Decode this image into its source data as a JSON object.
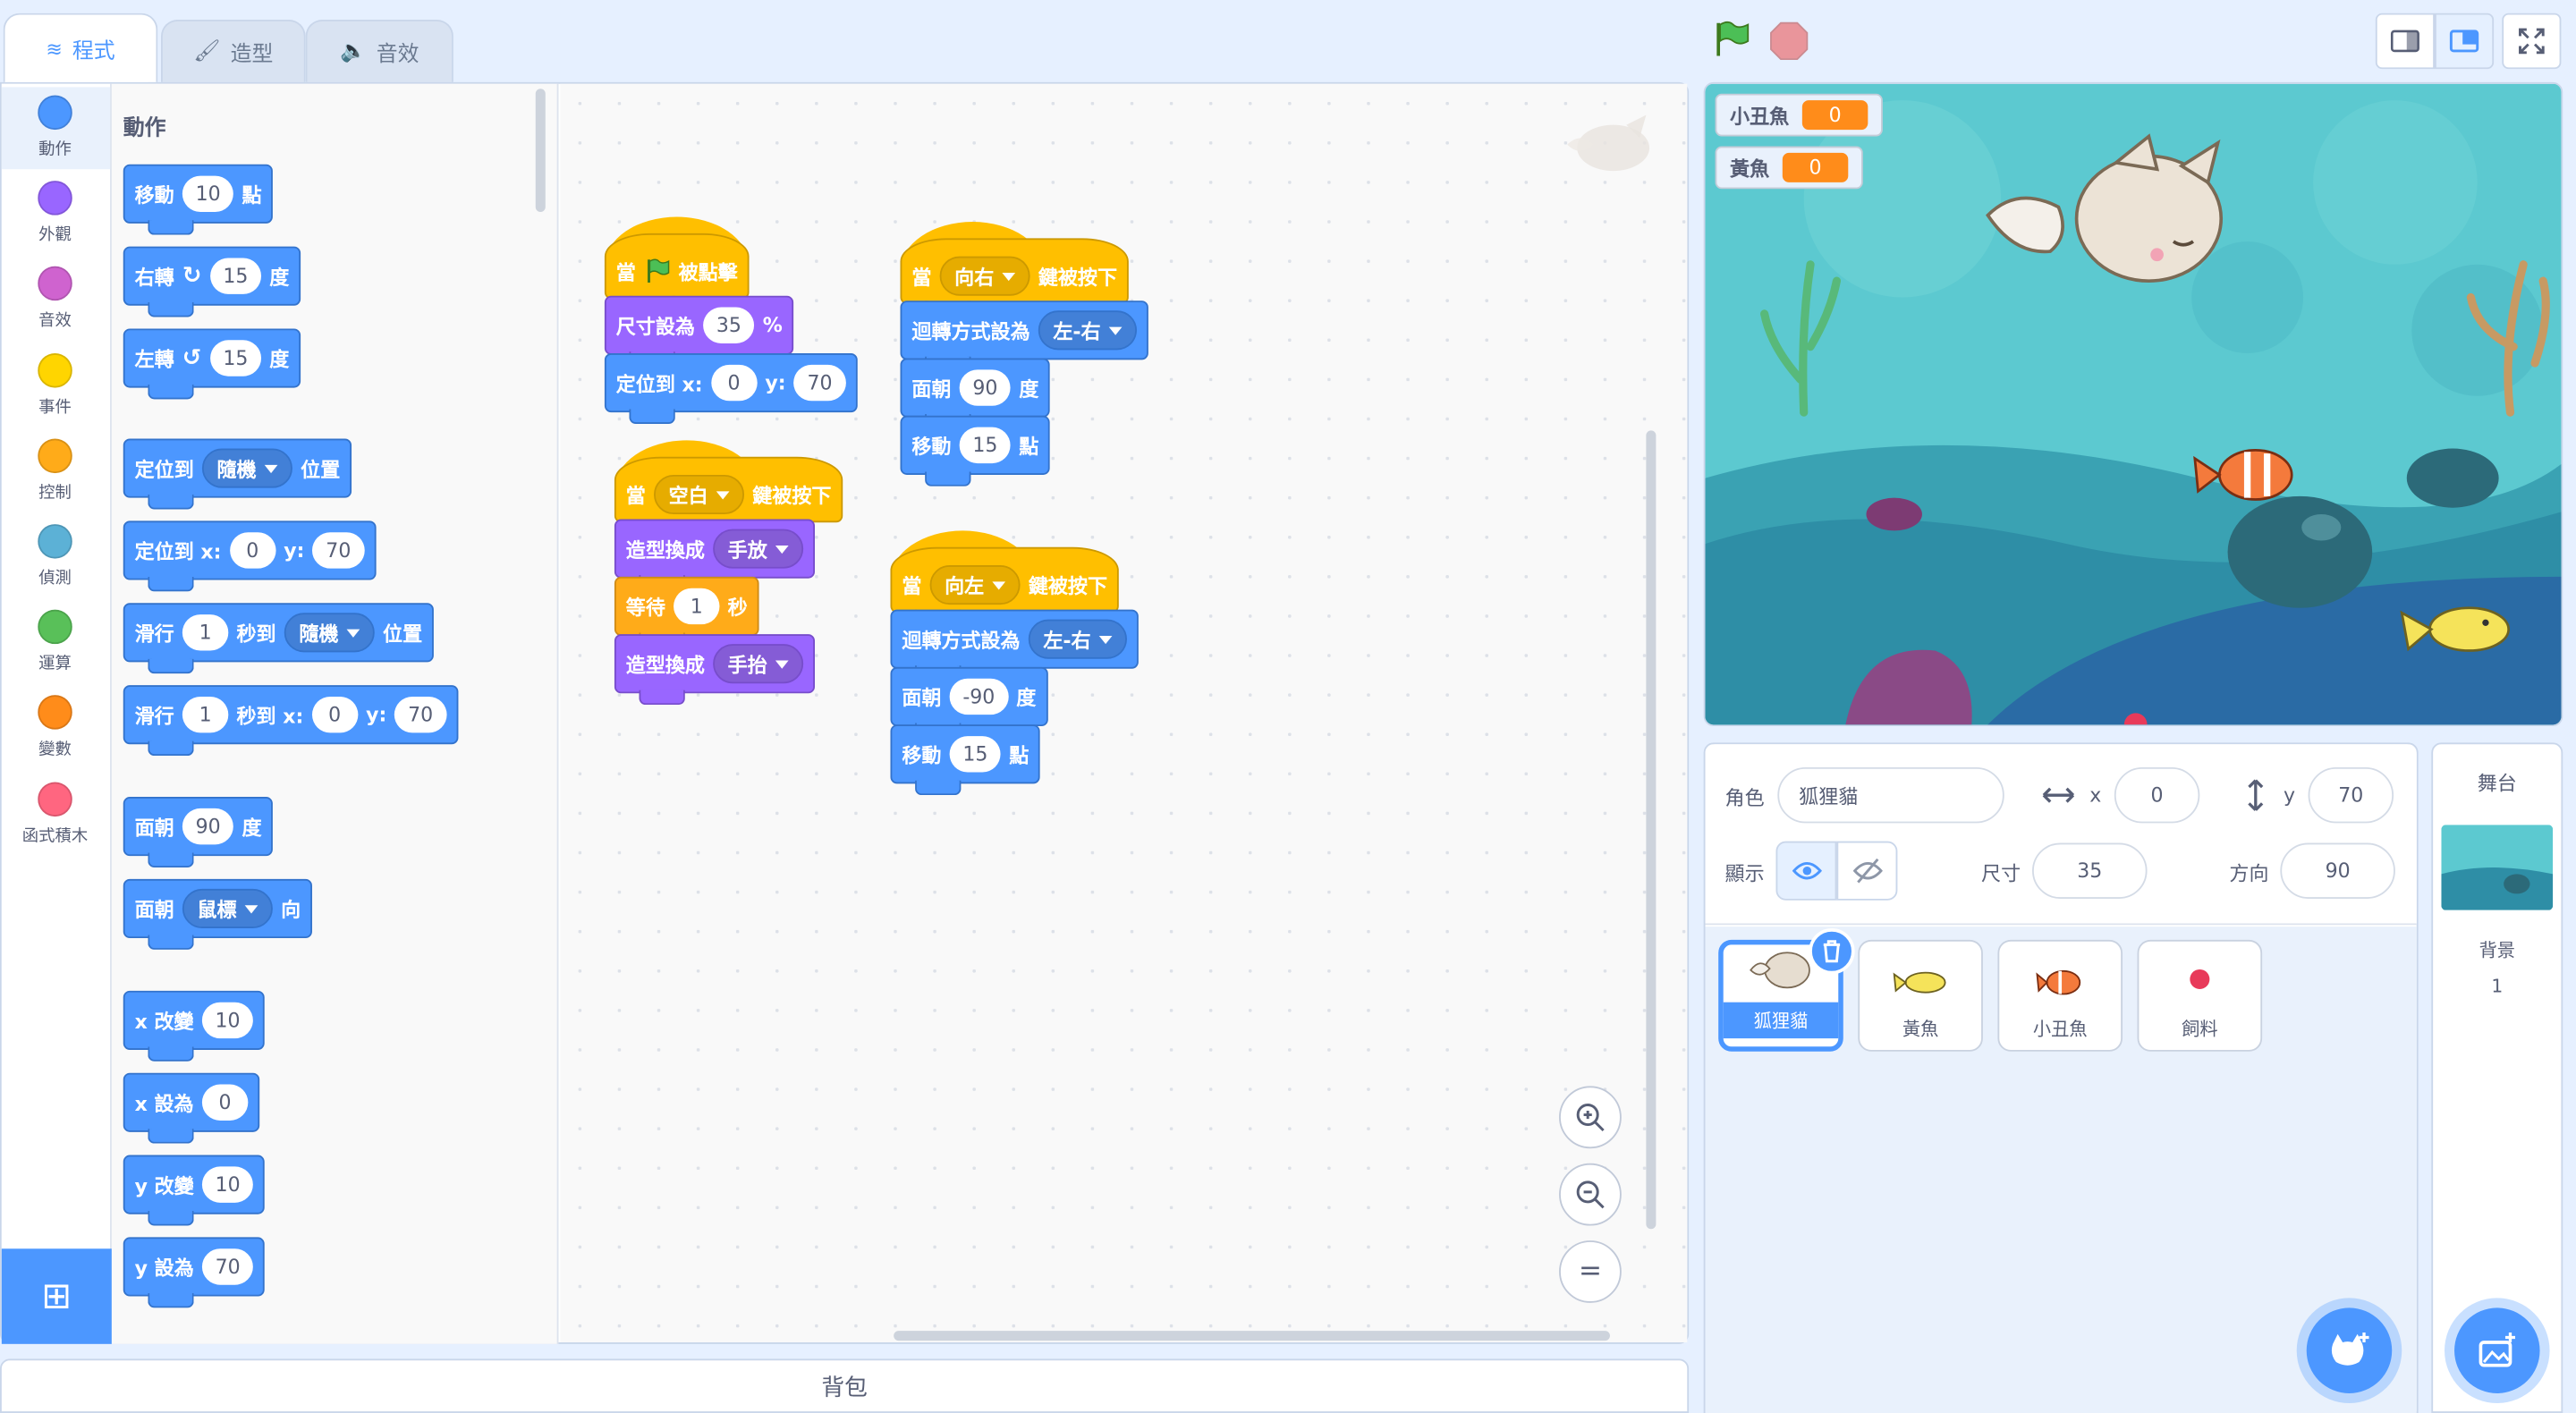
{
  "tabs": {
    "code": "程式",
    "costumes": "造型",
    "sounds": "音效"
  },
  "categories": [
    {
      "label": "動作",
      "color": "#4c97ff"
    },
    {
      "label": "外觀",
      "color": "#9966ff"
    },
    {
      "label": "音效",
      "color": "#cf63cf"
    },
    {
      "label": "事件",
      "color": "#ffd500"
    },
    {
      "label": "控制",
      "color": "#ffab19"
    },
    {
      "label": "偵測",
      "color": "#5cb1d6"
    },
    {
      "label": "運算",
      "color": "#59c059"
    },
    {
      "label": "變數",
      "color": "#ff8c1a"
    },
    {
      "label": "函式積木",
      "color": "#ff6680"
    }
  ],
  "palette": {
    "heading": "動作",
    "move": {
      "a": "移動",
      "v": "10",
      "b": "點"
    },
    "turn_right": {
      "a": "右轉",
      "v": "15",
      "b": "度"
    },
    "turn_left": {
      "a": "左轉",
      "v": "15",
      "b": "度"
    },
    "goto": {
      "a": "定位到",
      "v": "隨機",
      "b": "位置"
    },
    "goto_xy": {
      "a": "定位到 x:",
      "x": "0",
      "y_label": "y:",
      "y": "70"
    },
    "glide": {
      "a": "滑行",
      "v": "1",
      "b": "秒到",
      "d": "隨機",
      "c": "位置"
    },
    "glide_xy": {
      "a": "滑行",
      "v": "1",
      "b": "秒到 x:",
      "x": "0",
      "y_label": "y:",
      "y": "70"
    },
    "point": {
      "a": "面朝",
      "v": "90",
      "b": "度"
    },
    "point_towards": {
      "a": "面朝",
      "v": "鼠標",
      "b": "向"
    },
    "change_x": {
      "a": "x 改變",
      "v": "10"
    },
    "set_x": {
      "a": "x 設為",
      "v": "0"
    },
    "change_y": {
      "a": "y 改變",
      "v": "10"
    },
    "set_y": {
      "a": "y 設為",
      "v": "70"
    }
  },
  "scripts": {
    "s1": {
      "hat_a": "當",
      "hat_b": "被點擊",
      "size_a": "尺寸設為",
      "size_v": "35",
      "size_b": "%",
      "goto_a": "定位到 x:",
      "goto_x": "0",
      "goto_yl": "y:",
      "goto_y": "70"
    },
    "s2": {
      "hat_a": "當",
      "hat_key": "空白",
      "hat_b": "鍵被按下",
      "c1_a": "造型換成",
      "c1_v": "手放",
      "wait_a": "等待",
      "wait_v": "1",
      "wait_b": "秒",
      "c2_a": "造型換成",
      "c2_v": "手抬"
    },
    "s3": {
      "hat_a": "當",
      "hat_key": "向右",
      "hat_b": "鍵被按下",
      "rot_a": "迴轉方式設為",
      "rot_v": "左-右",
      "pt_a": "面朝",
      "pt_v": "90",
      "pt_b": "度",
      "mv_a": "移動",
      "mv_v": "15",
      "mv_b": "點"
    },
    "s4": {
      "hat_a": "當",
      "hat_key": "向左",
      "hat_b": "鍵被按下",
      "rot_a": "迴轉方式設為",
      "rot_v": "左-右",
      "pt_a": "面朝",
      "pt_v": "-90",
      "pt_b": "度",
      "mv_a": "移動",
      "mv_v": "15",
      "mv_b": "點"
    }
  },
  "zoom": {
    "reset": "="
  },
  "backpack": "背包",
  "monitors": [
    {
      "name": "小丑魚",
      "value": "0"
    },
    {
      "name": "黃魚",
      "value": "0"
    }
  ],
  "info": {
    "sprite_label": "角色",
    "sprite_name": "狐狸貓",
    "x_label": "x",
    "x": "0",
    "y_label": "y",
    "y": "70",
    "show_label": "顯示",
    "size_label": "尺寸",
    "size": "35",
    "dir_label": "方向",
    "dir": "90"
  },
  "sprites": [
    {
      "name": "狐狸貓"
    },
    {
      "name": "黃魚"
    },
    {
      "name": "小丑魚"
    },
    {
      "name": "飼料"
    }
  ],
  "stage_panel": {
    "title": "舞台",
    "backdrops_label": "背景",
    "backdrops_count": "1"
  },
  "colors": {
    "motion": "#4c97ff",
    "looks": "#9966ff",
    "events": "#ffbf00",
    "control": "#ffab19",
    "monitor": "#ff8c1a",
    "accent": "#4c97ff"
  }
}
